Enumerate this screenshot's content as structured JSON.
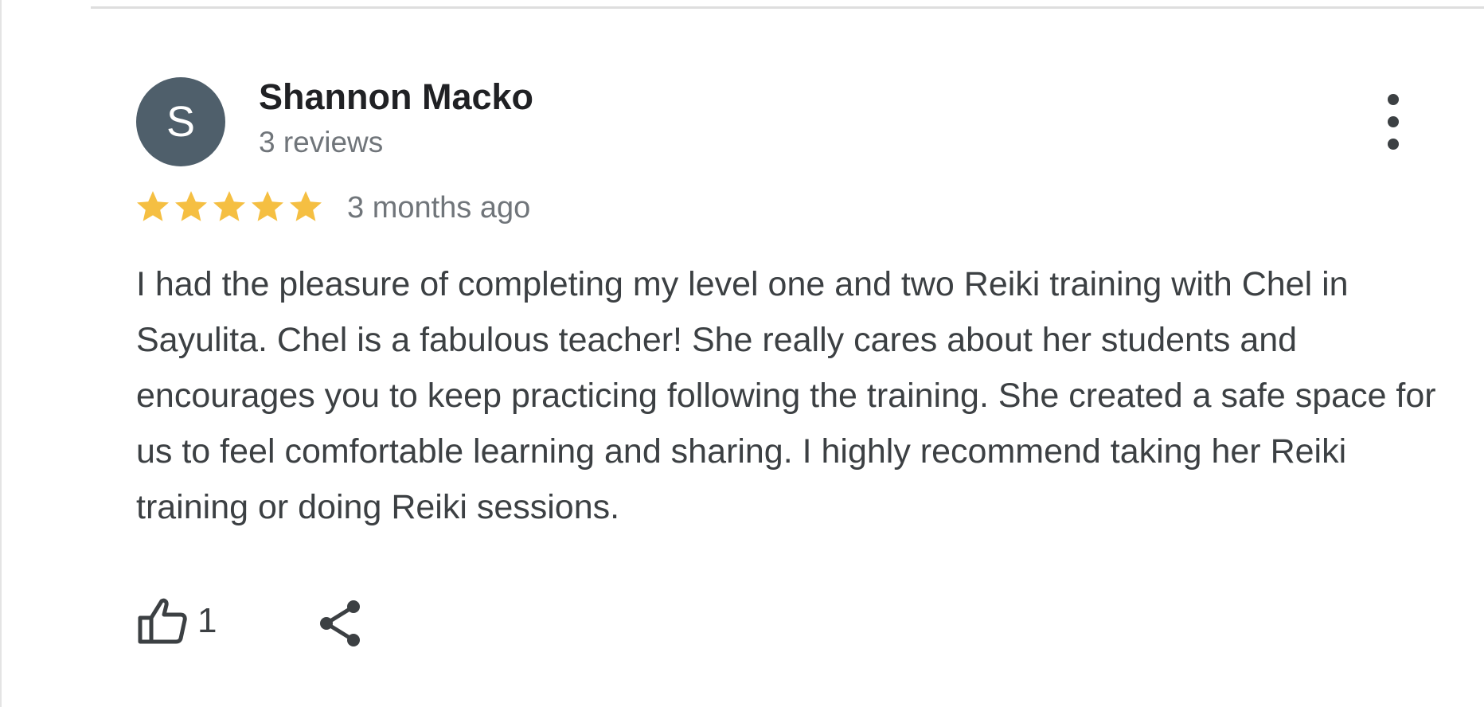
{
  "review": {
    "reviewer": {
      "initial": "S",
      "name": "Shannon Macko",
      "review_count": "3 reviews",
      "avatar_color": "#4f5f6b"
    },
    "rating": {
      "stars": 5,
      "max_stars": 5,
      "star_color": "#f5bf42"
    },
    "date": "3 months ago",
    "text": "I had the pleasure of completing my level one and two Reiki training with Chel in Sayulita. Chel is a fabulous teacher! She really cares about her students and encourages you to keep practicing following the training. She created a safe space for us to feel comfortable learning and sharing. I highly recommend taking her Reiki training or doing Reiki sessions.",
    "actions": {
      "like_icon": "thumbs-up-icon",
      "like_count": "1",
      "share_icon": "share-icon",
      "more_icon": "more-vert-icon"
    }
  }
}
